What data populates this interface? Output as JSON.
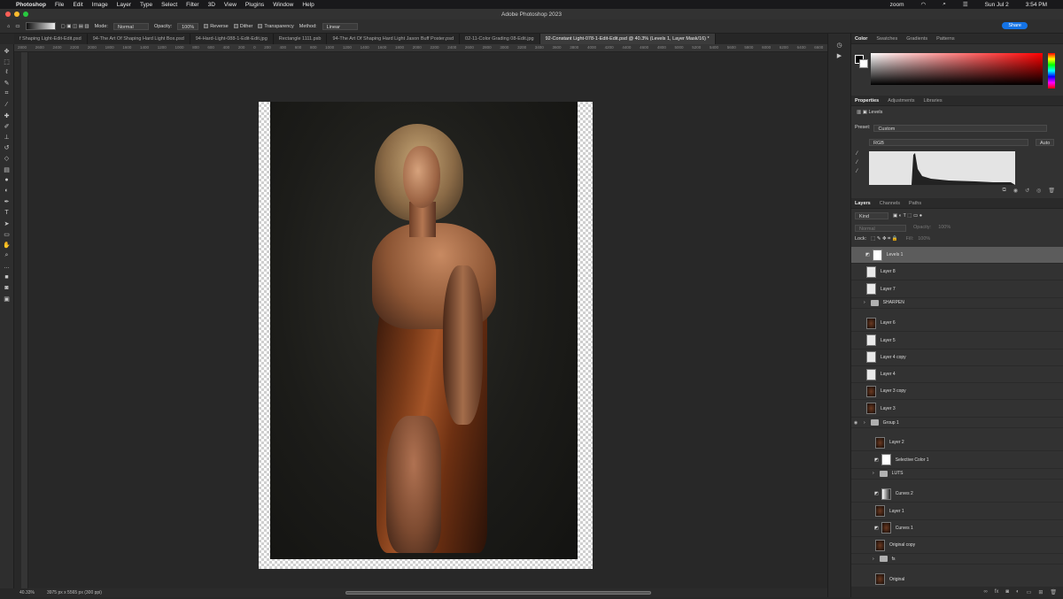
{
  "menubar": {
    "apple": "",
    "app": "Photoshop",
    "items": [
      "File",
      "Edit",
      "Image",
      "Layer",
      "Type",
      "Select",
      "Filter",
      "3D",
      "View",
      "Plugins",
      "Window",
      "Help"
    ],
    "right": {
      "zoom": "zoom",
      "date": "Sun Jul 2",
      "time": "3:54 PM"
    }
  },
  "window": {
    "title": "Adobe Photoshop 2023"
  },
  "options": {
    "mode_label": "Mode:",
    "mode_value": "Normal",
    "opacity_label": "Opacity:",
    "opacity_value": "100%",
    "reverse": "Reverse",
    "dither": "Dither",
    "transparency": "Transparency",
    "method_label": "Method:",
    "method_value": "Linear",
    "share": "Share"
  },
  "tabs": [
    "f Shaping Light-Edit-Edit.psd",
    "94-The Art Of Shaping Hard Light Box.psd",
    "94-Hard-Light-088-1-Edit-Edit.jpg",
    "Rectangle 1111.psb",
    "94-The Art Of Shaping Hard Light Jason Buff Poster.psd",
    "02-11-Color Grading 08-Edit.jpg",
    "92-Constant Light-078-1-Edit-Edit.psd @ 40.3% (Levels 1, Layer Mask/16) *"
  ],
  "ruler": [
    "2800",
    "2600",
    "2400",
    "2200",
    "2000",
    "1800",
    "1600",
    "1400",
    "1200",
    "1000",
    "800",
    "600",
    "400",
    "200",
    "0",
    "200",
    "400",
    "600",
    "800",
    "1000",
    "1200",
    "1400",
    "1600",
    "1800",
    "2000",
    "2200",
    "2400",
    "2600",
    "2800",
    "3000",
    "3200",
    "3400",
    "3600",
    "3800",
    "4000",
    "4200",
    "4400",
    "4600",
    "4800",
    "5000",
    "5200",
    "5400",
    "5600",
    "5800",
    "6000",
    "6200",
    "6400",
    "6600"
  ],
  "status": {
    "zoom": "40.33%",
    "size": "3975 px x 5565 px (300 ppi)"
  },
  "panels": {
    "color_tabs": [
      "Color",
      "Swatches",
      "Gradients",
      "Patterns"
    ],
    "prop_tabs": [
      "Properties",
      "Adjustments",
      "Libraries"
    ],
    "levels": "Levels",
    "preset_label": "Preset:",
    "preset_value": "Custom",
    "channel": "RGB",
    "auto": "Auto",
    "layer_tabs": [
      "Layers",
      "Channels",
      "Paths"
    ],
    "kind": "Kind",
    "blend": "Normal",
    "opacity_label": "Opacity:",
    "opacity_value": "100%",
    "lock_label": "Lock:",
    "fill_label": "Fill:",
    "fill_value": "100%"
  },
  "layers": [
    {
      "name": "Levels 1",
      "type": "adj",
      "selected": true
    },
    {
      "name": "Layer 8",
      "type": "white"
    },
    {
      "name": "Layer 7",
      "type": "white"
    },
    {
      "name": "SHARPEN",
      "type": "folder"
    },
    {
      "name": "Layer 6",
      "type": "dark"
    },
    {
      "name": "Layer 5",
      "type": "white"
    },
    {
      "name": "Layer 4 copy",
      "type": "white"
    },
    {
      "name": "Layer 4",
      "type": "white"
    },
    {
      "name": "Layer 3 copy",
      "type": "dark"
    },
    {
      "name": "Layer 3",
      "type": "dark"
    },
    {
      "name": "Group 1",
      "type": "folder",
      "eye": true
    },
    {
      "name": "Layer 2",
      "type": "dark",
      "indent": true
    },
    {
      "name": "Selective Color 1",
      "type": "adj",
      "indent": true
    },
    {
      "name": "LUTS",
      "type": "folder",
      "indent": true
    },
    {
      "name": "Curves 2",
      "type": "curve",
      "indent": true
    },
    {
      "name": "Layer 1",
      "type": "dark",
      "indent": true
    },
    {
      "name": "Curves 1",
      "type": "curve2",
      "indent": true
    },
    {
      "name": "Original copy",
      "type": "dark",
      "indent": true
    },
    {
      "name": "fs",
      "type": "folder",
      "indent": true
    },
    {
      "name": "Original",
      "type": "dark",
      "indent": true
    },
    {
      "name": "Old",
      "type": "folder",
      "eye": true
    }
  ]
}
